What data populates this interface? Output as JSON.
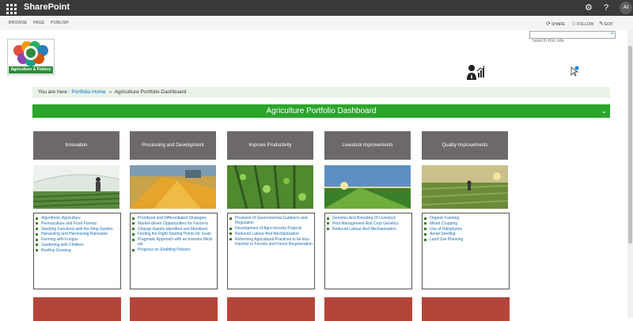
{
  "suitebar": {
    "app_name": "SharePoint",
    "icons": [
      "waffle-icon",
      "gear-icon",
      "help-icon"
    ],
    "avatar_initials": "AI"
  },
  "ribbon": {
    "tabs": [
      "BROWSE",
      "PAGE",
      "PUBLISH"
    ],
    "actions": [
      {
        "label": "SHARE",
        "icon": "share-icon"
      },
      {
        "label": "FOLLOW",
        "icon": "star-icon"
      },
      {
        "label": "EDIT",
        "icon": "pencil-icon"
      }
    ]
  },
  "search": {
    "placeholder": "Search this site"
  },
  "logo": {
    "caption": "Agriculture & Fishery"
  },
  "breadcrumb": {
    "prefix": "You are here :",
    "home": "Portfolio-Home",
    "separator": "»",
    "current": "Agriculture Portfolio-Dashboard"
  },
  "banner": {
    "title": "Agriculture Portfolio Dashboard"
  },
  "cards": [
    {
      "title": "Innovation",
      "items": [
        "Algorithmic Agriculture",
        "Permaculture and Food Forests",
        "Stacking Functions with the Ring Garden",
        "Harvesting and Harnessing Rainwater",
        "Farming with Fungus",
        "Gardening with Children",
        "Rooftop Growing"
      ]
    },
    {
      "title": "Processing and Development",
      "items": [
        "Prioritized and Differentiated Strategies",
        "Market-driven Opportunities for Farmers",
        "Change Agents Identified and Mobilized",
        "Finding the Right Starting Points for Scale",
        "Pragmatic Approach with an Investor Mind-set",
        "Progress on Enabling Policies"
      ]
    },
    {
      "title": "Improve Productivity",
      "items": [
        "Provision of Governmental Guidance and Regulation",
        "Development of Agro-forestry Projects",
        "Reduced Labour And Mechanisation",
        "Reforming Agricultural Practices to be less Harmful to Forests and Forest Regeneration"
      ]
    },
    {
      "title": "Livestock improvements",
      "items": [
        "Genetics And Breeding Of Livestock",
        "Pest Management And Crop Genetics",
        "Reduced Labour And Mechanisation"
      ]
    },
    {
      "title": "Quality Improvements",
      "items": [
        "Organic Farming",
        "Mixed Cropping",
        "Use of Halophytes",
        "Aerial Seeding",
        "Land Use Planning"
      ]
    }
  ]
}
